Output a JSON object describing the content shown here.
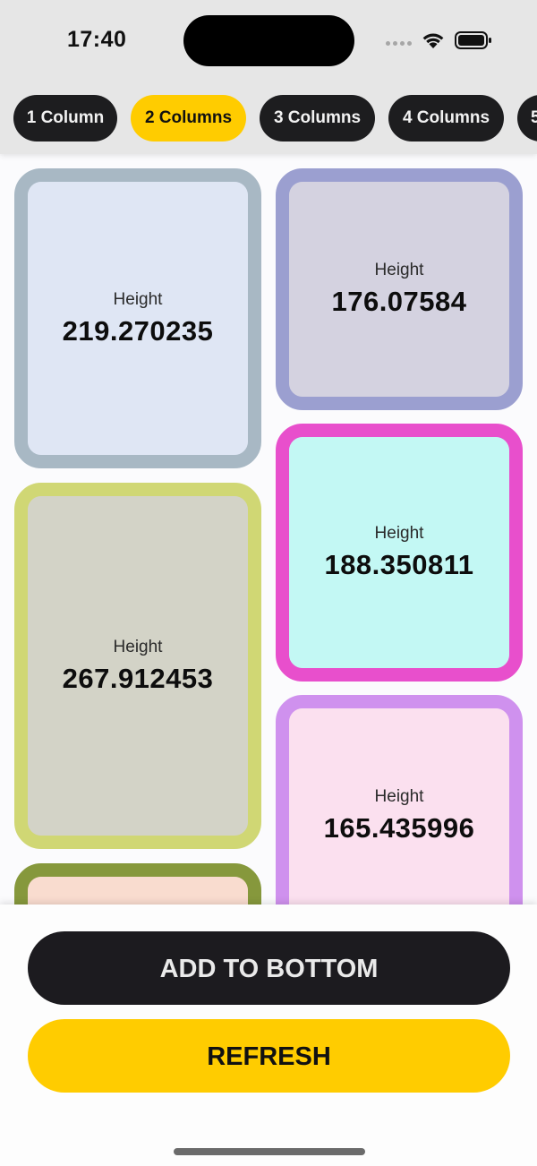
{
  "status_bar": {
    "time": "17:40"
  },
  "tabs": [
    {
      "label": "1 Column",
      "active": false
    },
    {
      "label": "2 Columns",
      "active": true
    },
    {
      "label": "3 Columns",
      "active": false
    },
    {
      "label": "4 Columns",
      "active": false
    },
    {
      "label": "5",
      "active": false
    }
  ],
  "cards": [
    {
      "label": "Height",
      "value": "219.270235",
      "border_color": "#a8b8c4",
      "fill_color": "#dfe6f4"
    },
    {
      "label": "Height",
      "value": "176.07584",
      "border_color": "#9b9fd0",
      "fill_color": "#d4d2e0"
    },
    {
      "label": "Height",
      "value": "188.350811",
      "border_color": "#e84fcc",
      "fill_color": "#c3f8f4"
    },
    {
      "label": "Height",
      "value": "267.912453",
      "border_color": "#d0d774",
      "fill_color": "#d3d3c7"
    },
    {
      "label": "Height",
      "value": "165.435996",
      "border_color": "#cf91ee",
      "fill_color": "#fbe0ef"
    },
    {
      "label": "",
      "value": "",
      "border_color": "#86983c",
      "fill_color": "#f9dccf"
    }
  ],
  "actions": {
    "add_to_bottom": "ADD TO BOTTOM",
    "refresh": "REFRESH"
  },
  "colors": {
    "accent": "#ffcc00",
    "dark": "#1c1b1f"
  }
}
